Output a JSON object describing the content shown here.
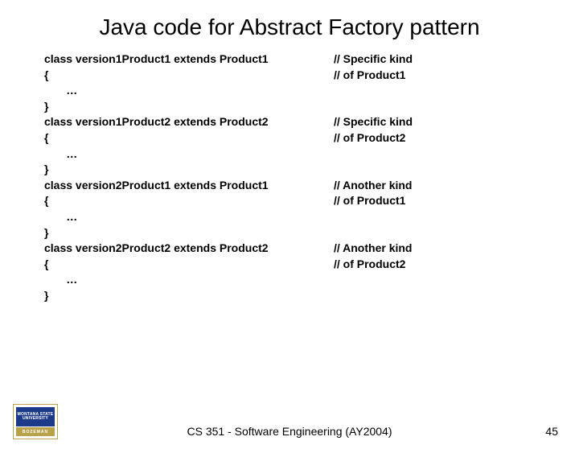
{
  "title": "Java code for Abstract Factory pattern",
  "rows": [
    {
      "left": "class version1Product1 extends Product1",
      "right": "// Specific kind"
    },
    {
      "left": "{",
      "right": "// of Product1"
    },
    {
      "left": "       …",
      "right": ""
    },
    {
      "left": "}",
      "right": ""
    },
    {
      "left": "class version1Product2 extends Product2",
      "right": "// Specific kind"
    },
    {
      "left": "{",
      "right": "// of Product2"
    },
    {
      "left": "       …",
      "right": ""
    },
    {
      "left": "}",
      "right": ""
    },
    {
      "left": "class version2Product1 extends Product1",
      "right": "// Another kind"
    },
    {
      "left": "{",
      "right": "// of Product1"
    },
    {
      "left": "       …",
      "right": ""
    },
    {
      "left": "}",
      "right": ""
    },
    {
      "left": "class version2Product2 extends Product2",
      "right": "// Another kind"
    },
    {
      "left": "{",
      "right": "// of Product2"
    },
    {
      "left": "       …",
      "right": ""
    },
    {
      "left": "}",
      "right": ""
    }
  ],
  "footer": "CS 351 - Software Engineering (AY2004)",
  "slide_number": "45",
  "logo": {
    "top": "MONTANA\nSTATE UNIVERSITY",
    "bottom": "BOZEMAN"
  }
}
